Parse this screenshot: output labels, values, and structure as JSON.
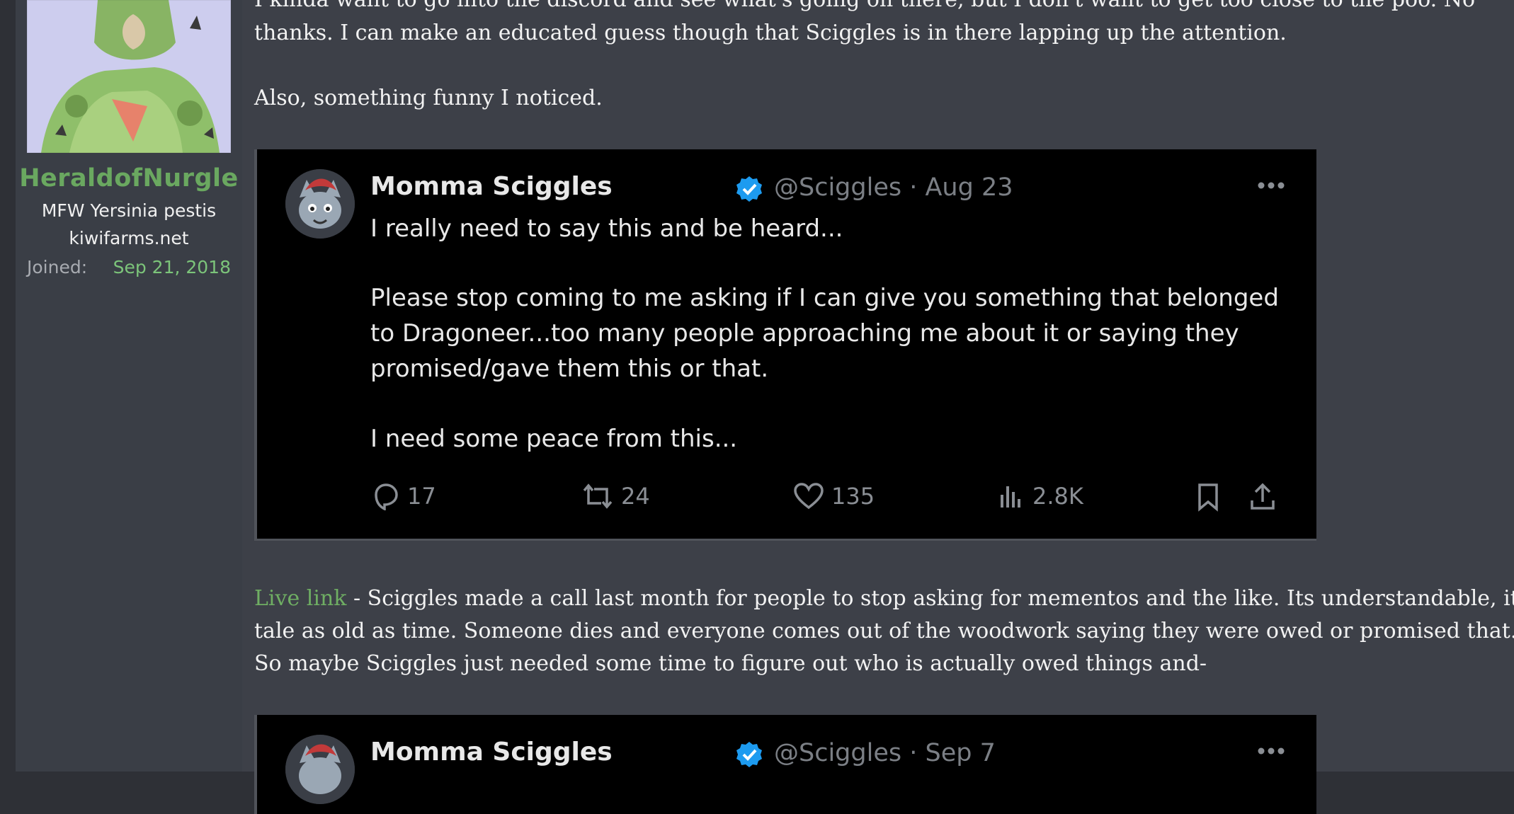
{
  "user": {
    "name": "HeraldofNurgle",
    "title": "MFW Yersinia pestis",
    "site": "kiwifarms.net",
    "joined_label": "Joined:",
    "joined_date": "Sep 21, 2018"
  },
  "post": {
    "line1": "I kinda want to go into the discord and see what's going on there, but I don't want to get too close to the poo. No",
    "line2": "thanks. I can make an educated guess though that Sciggles is in there lapping up the attention.",
    "line3": "Also, something funny I noticed.",
    "link_text": "Live link",
    "para2_line1": " - Sciggles made a call last month for people to stop asking for mementos and the like. Its understandable, it's a",
    "para2_line2": "tale as old as time. Someone dies and everyone comes out of the woodwork saying they were owed or promised that.",
    "para2_line3": "So maybe Sciggles just needed some time to figure out who is actually owed things and-"
  },
  "tweet1": {
    "name": "Momma Sciggles",
    "handle": "@Sciggles · Aug 23",
    "line1": "I really need to say this and be heard...",
    "line2": "Please stop coming to me asking if I can give you something that belonged",
    "line3": "to Dragoneer...too many people approaching me about it or saying they",
    "line4": "promised/gave them this or that.",
    "line5": "I need some peace from this...",
    "replies": "17",
    "retweets": "24",
    "likes": "135",
    "views": "2.8K"
  },
  "tweet2": {
    "name": "Momma Sciggles",
    "handle": "@Sciggles · Sep 7"
  },
  "icons": [
    "reply-icon",
    "retweet-icon",
    "like-icon",
    "views-icon",
    "bookmark-icon",
    "share-icon",
    "verified-icon",
    "more-icon"
  ],
  "colors": {
    "username": "#6aa860",
    "joined_date": "#7cc47a",
    "link": "#6fae63",
    "verified": "#1d9bf0",
    "tweet_bg": "#000000",
    "post_bg": "#3d4048"
  }
}
